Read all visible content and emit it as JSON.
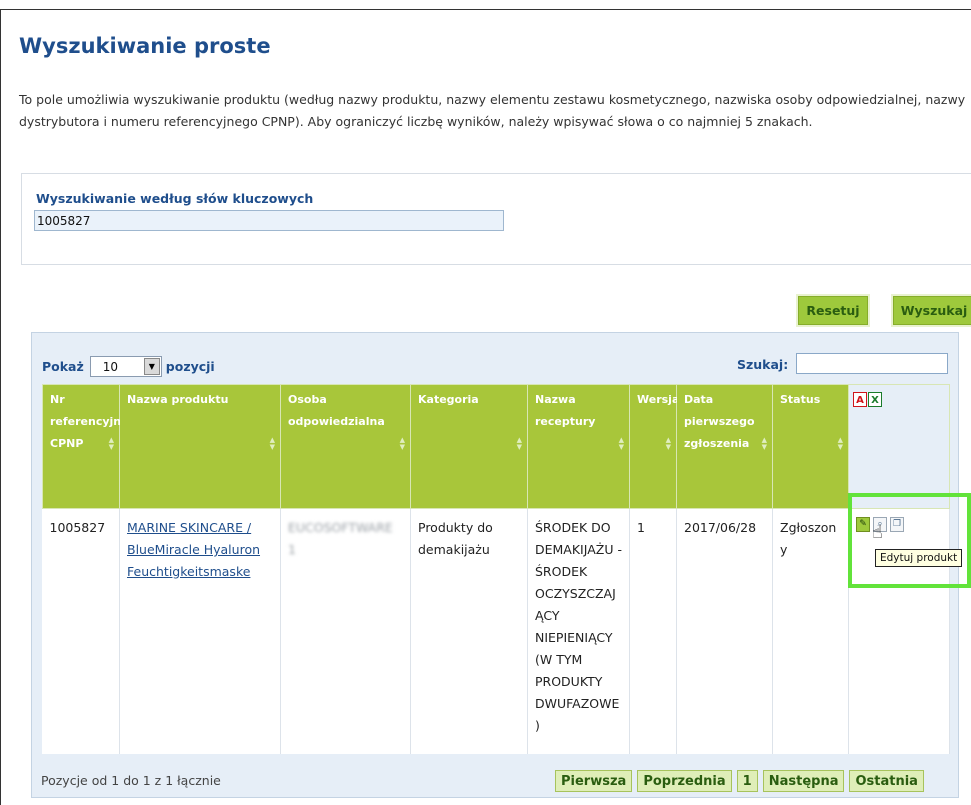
{
  "page": {
    "title": "Wyszukiwanie proste",
    "intro": "To pole umożliwia wyszukiwanie produktu (według nazwy produktu, nazwy elementu zestawu kosmetycznego, nazwiska osoby odpowiedzialnej, nazwy dystrybutora i numeru referencyjnego CPNP). Aby ograniczyć liczbę wyników, należy wpisywać słowa o co najmniej 5 znakach."
  },
  "search": {
    "label": "Wyszukiwanie według słów kluczowych",
    "value": "1005827",
    "reset_label": "Resetuj",
    "search_label": "Wyszukaj"
  },
  "table_controls": {
    "show_label": "Pokaż",
    "page_length": "10",
    "entries_label": "pozycji",
    "filter_label": "Szukaj:",
    "filter_value": ""
  },
  "table": {
    "columns": [
      "Nr referencyjny CPNP",
      "Nazwa produktu",
      "Osoba odpowiedzialna",
      "Kategoria",
      "Nazwa receptury",
      "Wersja",
      "Data pierwszego zgłoszenia",
      "Status"
    ],
    "rows": [
      {
        "cpnp": "1005827",
        "product_name": "MARINE SKINCARE / BlueMiracle Hyaluron Feuchtigkeitsmaske",
        "responsible": "EUCOSOFTWARE 1",
        "category": "Produkty do demakijażu",
        "frame_formulation": "ŚRODEK DO DEMAKIJAŻU - ŚRODEK OCZYSZCZAJĄCY NIEPIENIĄCY (W TYM PRODUKTY DWUFAZOWE)",
        "version": "1",
        "first_notification": "2017/06/28",
        "status": "Zgłoszony"
      }
    ]
  },
  "tooltip": "Edytuj produkt",
  "footer": {
    "info": "Pozycje od 1 do 1 z 1 łącznie",
    "first": "Pierwsza",
    "previous": "Poprzednia",
    "page": "1",
    "next": "Następna",
    "last": "Ostatnia"
  },
  "icons": {
    "export": [
      "pdf-icon",
      "excel-icon"
    ],
    "actions": [
      "edit-icon",
      "view-icon",
      "copy-icon"
    ]
  },
  "colors": {
    "header_green": "#a8c63a",
    "title_blue": "#1f4e8c",
    "highlight": "#62e33a"
  }
}
